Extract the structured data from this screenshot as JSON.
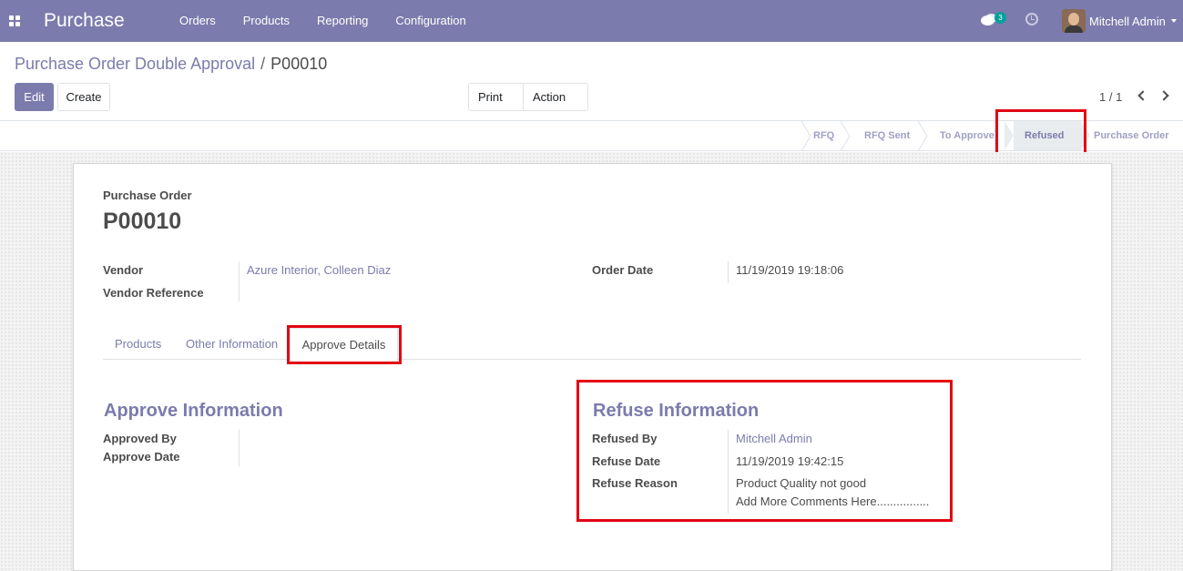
{
  "navbar": {
    "app_name": "Purchase",
    "menu": [
      "Orders",
      "Products",
      "Reporting",
      "Configuration"
    ],
    "chat_badge": "3",
    "user_name": "Mitchell Admin"
  },
  "breadcrumb": {
    "parent": "Purchase Order Double Approval",
    "separator": "/",
    "current": "P00010"
  },
  "buttons": {
    "edit": "Edit",
    "create": "Create",
    "print": "Print",
    "action": "Action"
  },
  "pager": {
    "value": "1 / 1"
  },
  "status_bar": {
    "stages": [
      "RFQ",
      "RFQ Sent",
      "To Approve",
      "Refused",
      "Purchase Order"
    ],
    "active": "Refused"
  },
  "form": {
    "doc_label": "Purchase Order",
    "doc_name": "P00010",
    "vendor_label": "Vendor",
    "vendor_value": "Azure Interior, Colleen Diaz",
    "vendor_ref_label": "Vendor Reference",
    "order_date_label": "Order Date",
    "order_date_value": "11/19/2019 19:18:06"
  },
  "tabs": [
    "Products",
    "Other Information",
    "Approve Details"
  ],
  "approve_info": {
    "title": "Approve Information",
    "approved_by_label": "Approved By",
    "approve_date_label": "Approve Date"
  },
  "refuse_info": {
    "title": "Refuse Information",
    "refused_by_label": "Refused By",
    "refused_by_value": "Mitchell Admin",
    "refuse_date_label": "Refuse Date",
    "refuse_date_value": "11/19/2019 19:42:15",
    "refuse_reason_label": "Refuse Reason",
    "refuse_reason_line1": "Product Quality not good",
    "refuse_reason_line2": "Add More Comments Here................"
  },
  "colors": {
    "brand": "#7c7bad",
    "highlight": "#e20613"
  }
}
